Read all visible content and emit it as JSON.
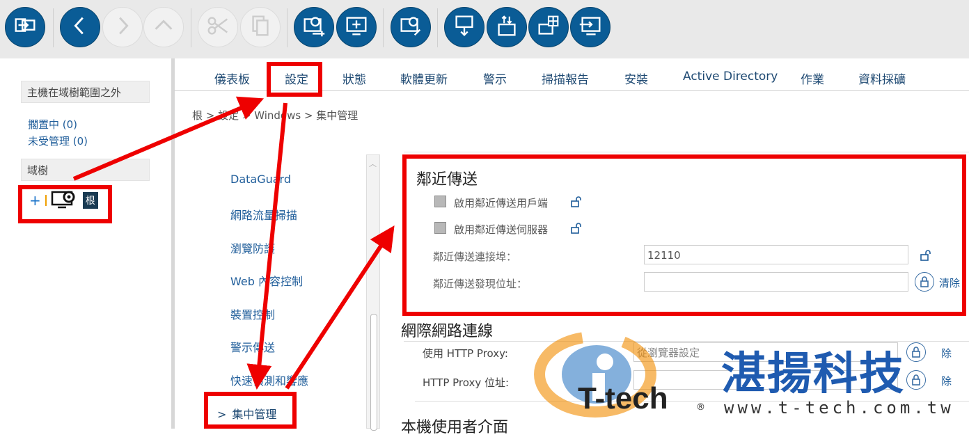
{
  "toolbar": {
    "buttons": [
      {
        "icon": "login-arrow-icon",
        "enabled": true
      },
      {
        "icon": "back-icon",
        "enabled": true
      },
      {
        "icon": "forward-icon",
        "enabled": false
      },
      {
        "icon": "up-icon",
        "enabled": false
      },
      {
        "icon": "cut-icon",
        "enabled": false
      },
      {
        "icon": "copy-icon",
        "enabled": false
      },
      {
        "icon": "settings-monitor-add-icon",
        "enabled": true
      },
      {
        "icon": "monitor-add-icon",
        "enabled": true
      },
      {
        "icon": "settings-monitor-edit-icon",
        "enabled": true
      },
      {
        "icon": "deploy-down-icon",
        "enabled": true
      },
      {
        "icon": "package-icon",
        "enabled": true
      },
      {
        "icon": "windows-monitor-icon",
        "enabled": true
      },
      {
        "icon": "monitor-import-icon",
        "enabled": true
      }
    ]
  },
  "left": {
    "outside_scope_header": "主機在域樹範圍之外",
    "pending": "擱置中 (0)",
    "unmanaged": "未受管理 (0)",
    "tree_header": "域樹",
    "tree_expand": "+",
    "root_label": "根"
  },
  "tabs": [
    "儀表板",
    "設定",
    "狀態",
    "軟體更新",
    "警示",
    "掃描報告",
    "安裝",
    "Active Directory",
    "作業",
    "資料採礦"
  ],
  "breadcrumb": "根 > 設定 > Windows > 集中管理",
  "side_menu": [
    "DataGuard",
    "網路流量掃描",
    "瀏覽防護",
    "Web 內容控制",
    "裝置控制",
    "警示傳送",
    "快速偵測和響應",
    "集中管理"
  ],
  "side_menu_selected_prefix": ">",
  "relay": {
    "title": "鄰近傳送",
    "enable_client": "啟用鄰近傳送用戶端",
    "enable_server": "啟用鄰近傳送伺服器",
    "port_label": "鄰近傳送連接埠：",
    "port_value": "12110",
    "discovery_label": "鄰近傳送發現位址：",
    "discovery_value": "",
    "clear_label": "清除"
  },
  "internet": {
    "title": "網際網路連線",
    "proxy_label": "使用 HTTP Proxy:",
    "proxy_value": "從瀏覽器設定",
    "proxy_address_label": "HTTP Proxy 位址:",
    "clear_label_1": "除",
    "clear_label_2": "除"
  },
  "local_ui_title": "本機使用者介面",
  "watermark": {
    "brand_cn": "湛揚科技",
    "brand_en": "T-tech",
    "registered": "®",
    "url": "www.t-tech.com.tw"
  },
  "colors": {
    "toolbar_button": "#0a5c96",
    "annotation_red": "#ee0000",
    "link_blue": "#1f5d9a"
  }
}
